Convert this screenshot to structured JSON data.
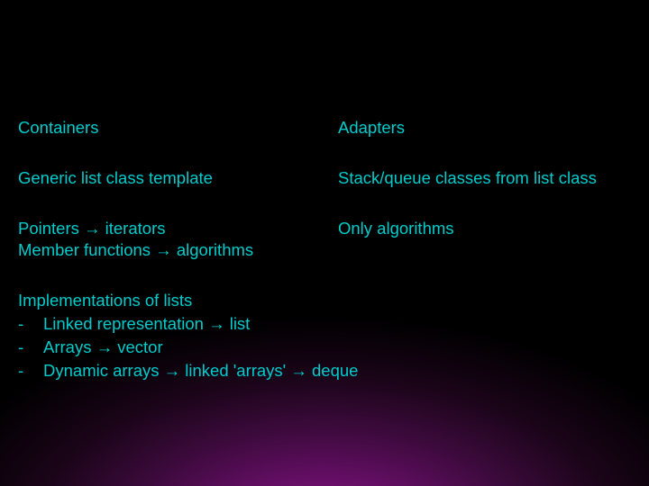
{
  "row1": {
    "left": "Containers",
    "right": "Adapters"
  },
  "row2": {
    "left": "Generic list class template",
    "right": "Stack/queue classes from list class"
  },
  "row3": {
    "left_line1": "Pointers → iterators",
    "left_line2": "Member functions → algorithms",
    "right": "Only algorithms"
  },
  "impl": {
    "title": "Implementations of lists",
    "dash": "-",
    "b1": "Linked representation → list",
    "b2": "Arrays → vector",
    "b3": "Dynamic arrays → linked 'arrays' → deque"
  }
}
